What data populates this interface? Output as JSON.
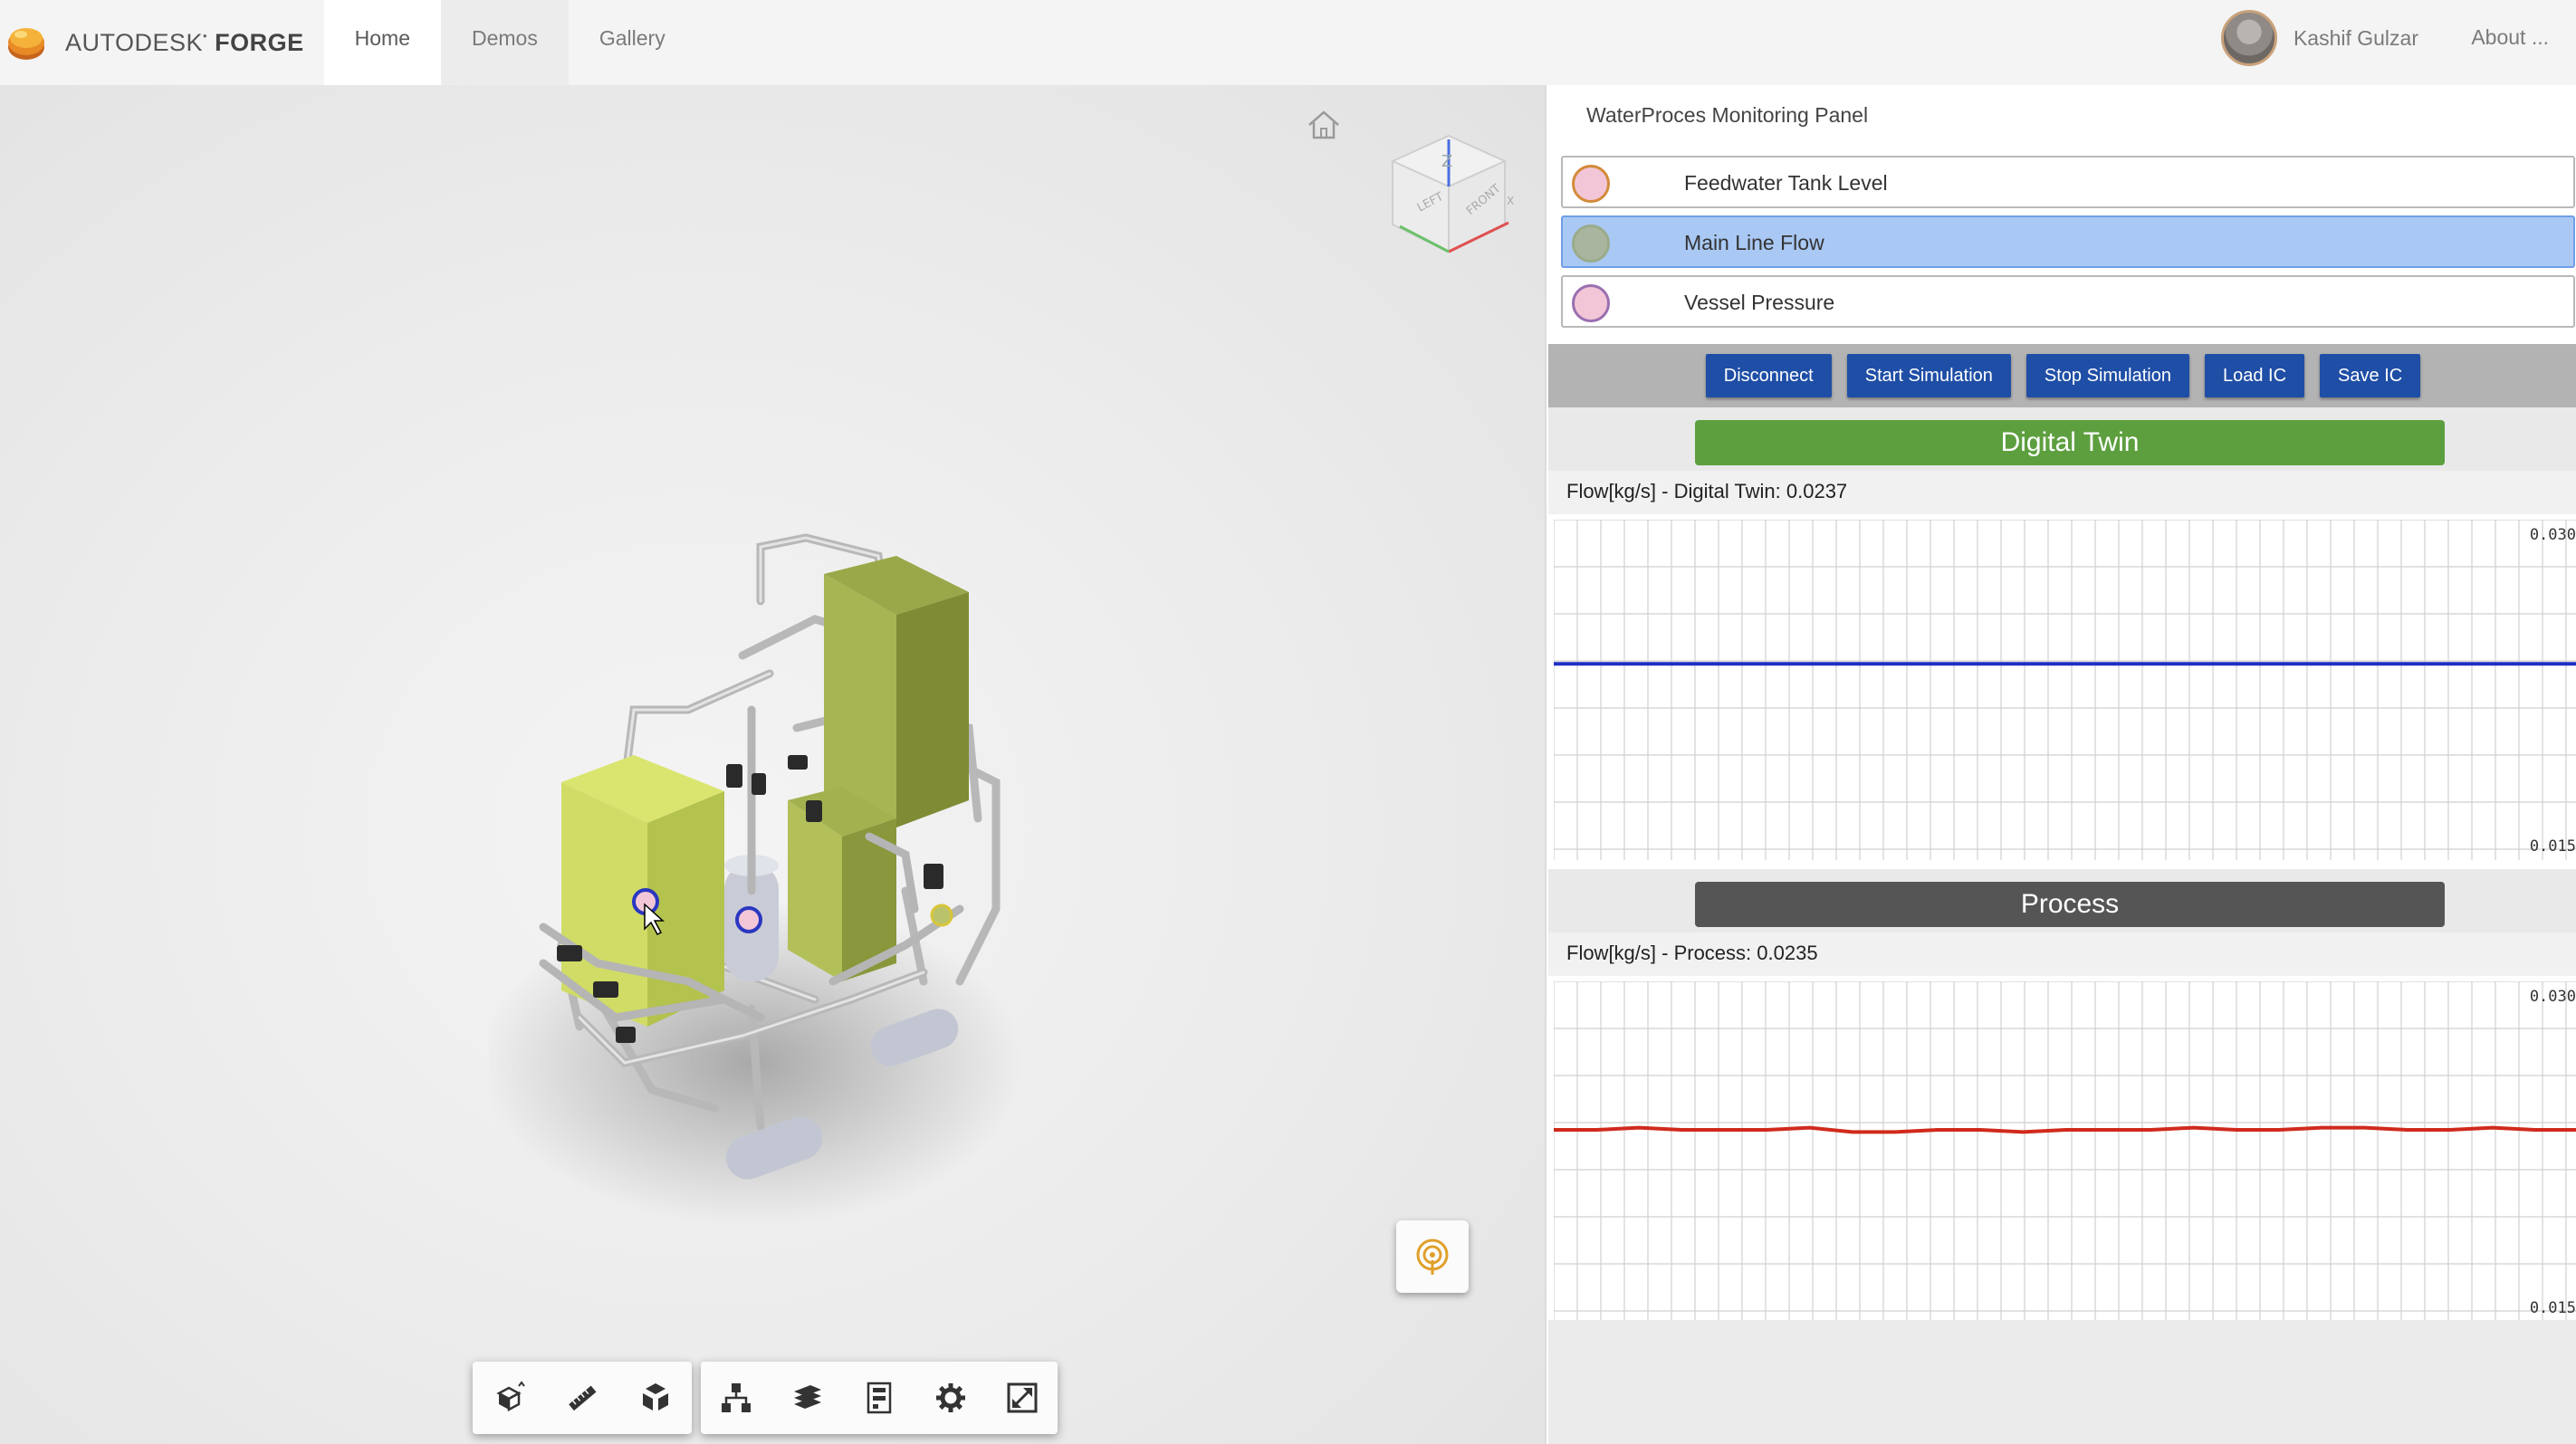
{
  "nav": {
    "brand_light": "AUTODESK",
    "brand_bold": "FORGE",
    "links": [
      "Home",
      "Demos",
      "Gallery"
    ],
    "user_name": "Kashif Gulzar",
    "about": "About ..."
  },
  "viewer": {
    "viewcube_faces": [
      "Z",
      "LEFT",
      "FRONT",
      "X"
    ],
    "toolbar_left": [
      "orbit-icon",
      "measure-icon",
      "explode-icon"
    ],
    "toolbar_right": [
      "model-browser-icon",
      "layers-icon",
      "properties-icon",
      "settings-icon",
      "fullscreen-icon"
    ]
  },
  "panel": {
    "title": "WaterProces Monitoring Panel",
    "sensors": [
      {
        "label": "Feedwater Tank Level",
        "dot_color": "#f2c6d6",
        "ring_color": "#d38a3a",
        "selected": false
      },
      {
        "label": "Main Line Flow",
        "dot_color": "#a9b59e",
        "ring_color": "#9aab8a",
        "selected": true
      },
      {
        "label": "Vessel Pressure",
        "dot_color": "#f2c6d6",
        "ring_color": "#9a6fb0",
        "selected": false
      }
    ],
    "buttons": [
      "Disconnect",
      "Start Simulation",
      "Stop Simulation",
      "Load IC",
      "Save IC"
    ],
    "digital_twin": {
      "banner": "Digital Twin",
      "readout": "Flow[kg/s] - Digital Twin: 0.0237",
      "y_max_label": "0.030",
      "y_min_label": "0.015",
      "line_color": "#1f2fc4"
    },
    "process": {
      "banner": "Process",
      "readout": "Flow[kg/s] - Process: 0.0235",
      "y_max_label": "0.030",
      "y_min_label": "0.015",
      "line_color": "#d02a1c"
    }
  },
  "chart_data": [
    {
      "type": "line",
      "ylim": [
        0.015,
        0.03
      ],
      "series": [
        {
          "values": [
            0.0237,
            0.0237,
            0.0237,
            0.0237,
            0.0237,
            0.0237,
            0.0237,
            0.0237,
            0.0237,
            0.0237,
            0.0237,
            0.0237,
            0.0237,
            0.0237,
            0.0237,
            0.0237,
            0.0237,
            0.0237,
            0.0237,
            0.0237,
            0.0237,
            0.0237,
            0.0237,
            0.0237,
            0.0237
          ]
        }
      ],
      "grid": true
    },
    {
      "type": "line",
      "ylim": [
        0.015,
        0.03
      ],
      "series": [
        {
          "values": [
            0.0235,
            0.0235,
            0.0236,
            0.0235,
            0.0235,
            0.0235,
            0.0236,
            0.0234,
            0.0234,
            0.0235,
            0.0235,
            0.0234,
            0.0235,
            0.0235,
            0.0235,
            0.0236,
            0.0235,
            0.0235,
            0.0236,
            0.0236,
            0.0235,
            0.0235,
            0.0236,
            0.0235,
            0.0235
          ]
        }
      ],
      "grid": true
    }
  ]
}
